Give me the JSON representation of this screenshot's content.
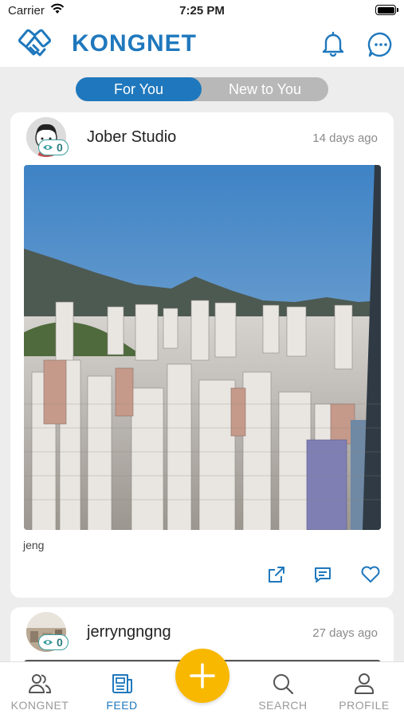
{
  "status_bar": {
    "carrier": "Carrier",
    "time": "7:25 PM"
  },
  "header": {
    "title": "KONGNET",
    "logo_icon": "handshake-icon",
    "icons": [
      "bell-icon",
      "chat-icon"
    ]
  },
  "segments": [
    {
      "label": "For You",
      "active": true
    },
    {
      "label": "New to You",
      "active": false
    }
  ],
  "posts": [
    {
      "author": "Jober Studio",
      "badge_count": "0",
      "time_ago": "14 days ago",
      "caption": "jeng",
      "actions": [
        "share-icon",
        "comment-icon",
        "heart-icon"
      ]
    },
    {
      "author": "jerryngngng",
      "badge_count": "0",
      "time_ago": "27 days ago"
    }
  ],
  "tabbar": {
    "items": [
      {
        "label": "KONGNET",
        "icon": "people-icon",
        "active": false
      },
      {
        "label": "FEED",
        "icon": "feed-icon",
        "active": true
      },
      {
        "label": "SEARCH",
        "icon": "search-icon",
        "active": false
      },
      {
        "label": "PROFILE",
        "icon": "profile-icon",
        "active": false
      }
    ],
    "fab_icon": "plus-icon"
  },
  "colors": {
    "brand": "#1f78bd",
    "fab": "#f8b800",
    "badge": "#3a9ea0",
    "inactive": "#b8b8b8"
  }
}
